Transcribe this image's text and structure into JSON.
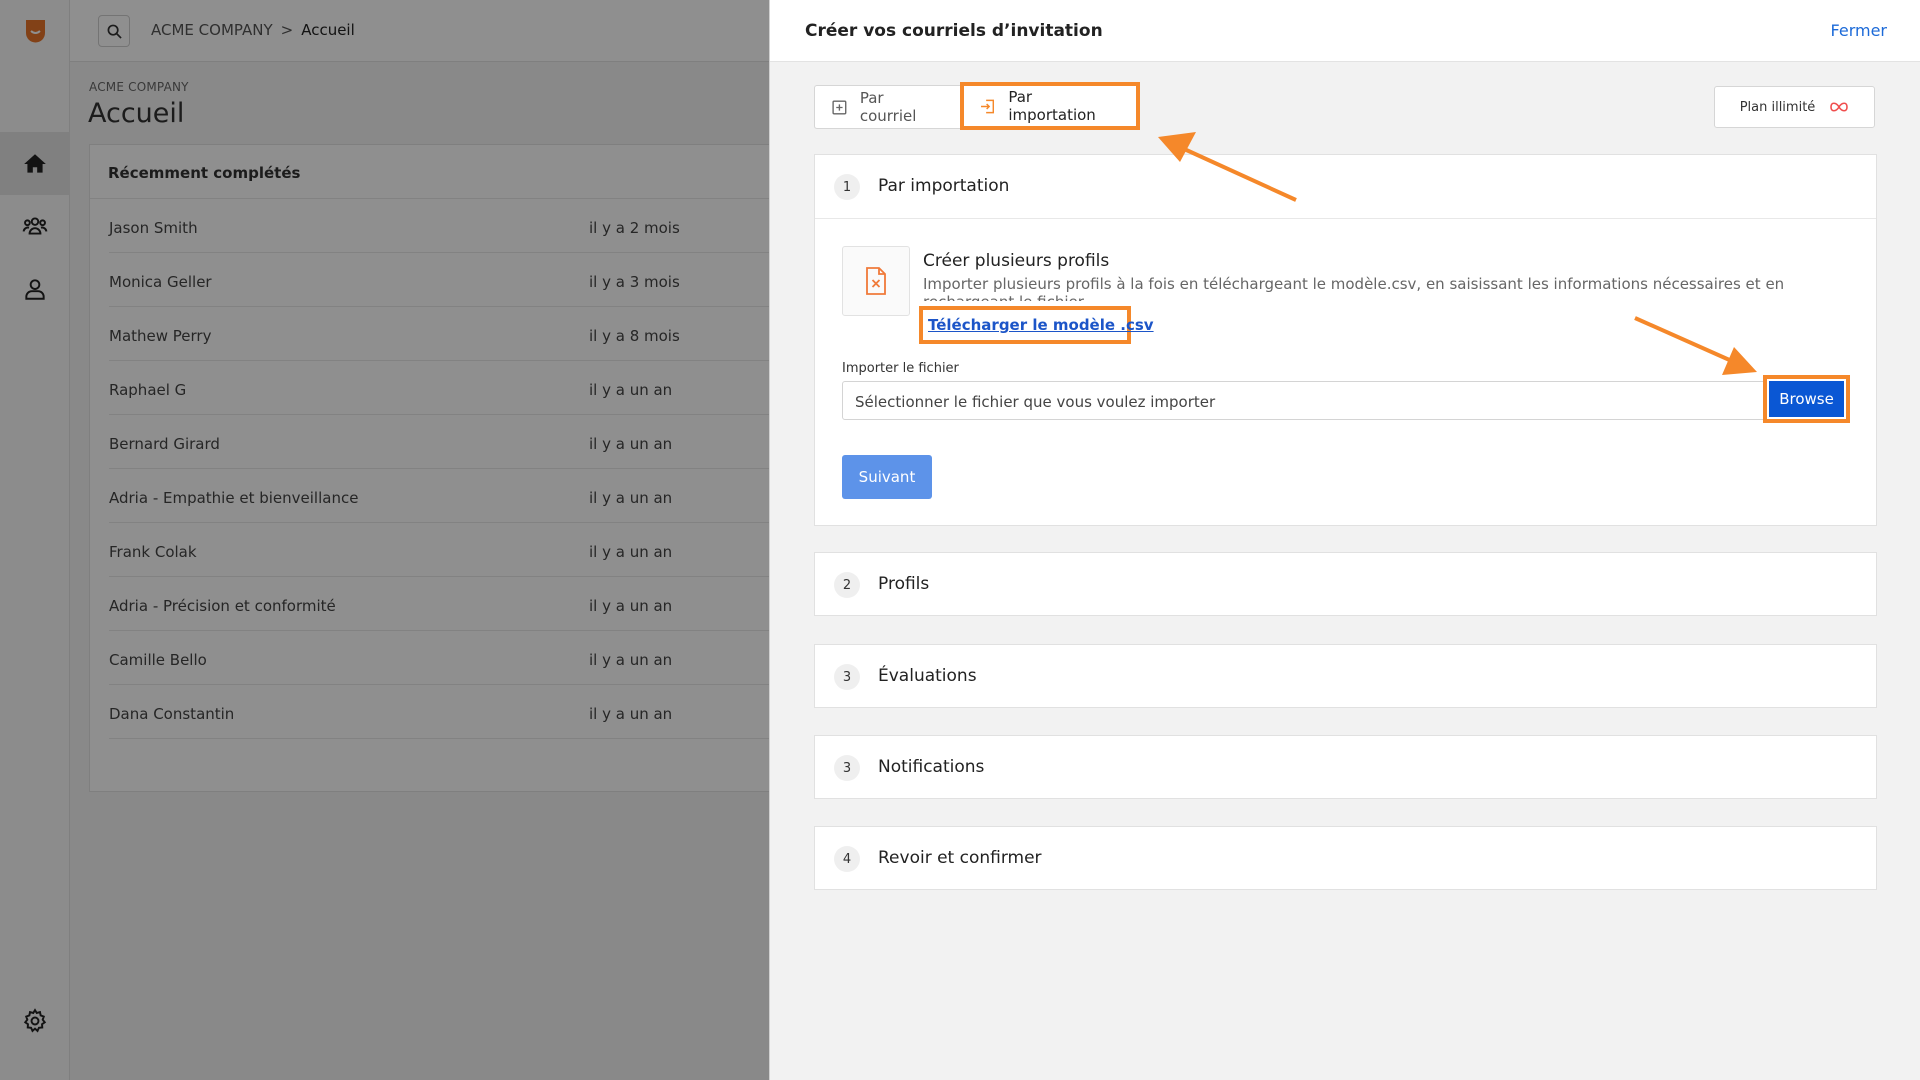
{
  "breadcrumb": {
    "company": "ACME COMPANY",
    "separator": ">",
    "current": "Accueil"
  },
  "page": {
    "subtitle": "ACME COMPANY",
    "title": "Accueil"
  },
  "recent": {
    "header": "Récemment complétés",
    "rows": [
      {
        "name": "Jason Smith",
        "time": "il y a 2 mois"
      },
      {
        "name": "Monica Geller",
        "time": "il y a 3 mois"
      },
      {
        "name": "Mathew Perry",
        "time": "il y a 8 mois"
      },
      {
        "name": "Raphael G",
        "time": "il y a un an"
      },
      {
        "name": "Bernard Girard",
        "time": "il y a un an"
      },
      {
        "name": "Adria - Empathie et bienveillance",
        "time": "il y a un an"
      },
      {
        "name": "Frank Colak",
        "time": "il y a un an"
      },
      {
        "name": "Adria - Précision et conformité",
        "time": "il y a un an"
      },
      {
        "name": "Camille Bello",
        "time": "il y a un an"
      },
      {
        "name": "Dana Constantin",
        "time": "il y a un an"
      }
    ]
  },
  "modal": {
    "title": "Créer vos courriels d’invitation",
    "close_label": "Fermer",
    "tabs": [
      {
        "label": "Par courriel",
        "icon": "plus-square-icon"
      },
      {
        "label": "Par importation",
        "icon": "import-icon"
      }
    ],
    "plan_label": "Plan illimité",
    "steps": [
      {
        "num": "1",
        "title": "Par importation"
      },
      {
        "num": "2",
        "title": "Profils"
      },
      {
        "num": "3",
        "title": "Évaluations"
      },
      {
        "num": "3",
        "title": "Notifications"
      },
      {
        "num": "4",
        "title": "Revoir et confirmer"
      }
    ],
    "import": {
      "bulk_title": "Créer plusieurs profils",
      "bulk_desc": "Importer plusieurs profils à la fois en téléchargeant le modèle.csv, en saisissant les informations nécessaires et en rechargeant le fichier",
      "download_link": "Télécharger le modèle .csv",
      "field_label": "Importer le fichier",
      "file_placeholder": "Sélectionner le fichier que vous voulez importer",
      "browse_label": "Browse",
      "next_label": "Suivant"
    }
  },
  "colors": {
    "accent_orange": "#f5882a",
    "primary_blue": "#0a57d4",
    "link_blue": "#1c6ad8"
  }
}
